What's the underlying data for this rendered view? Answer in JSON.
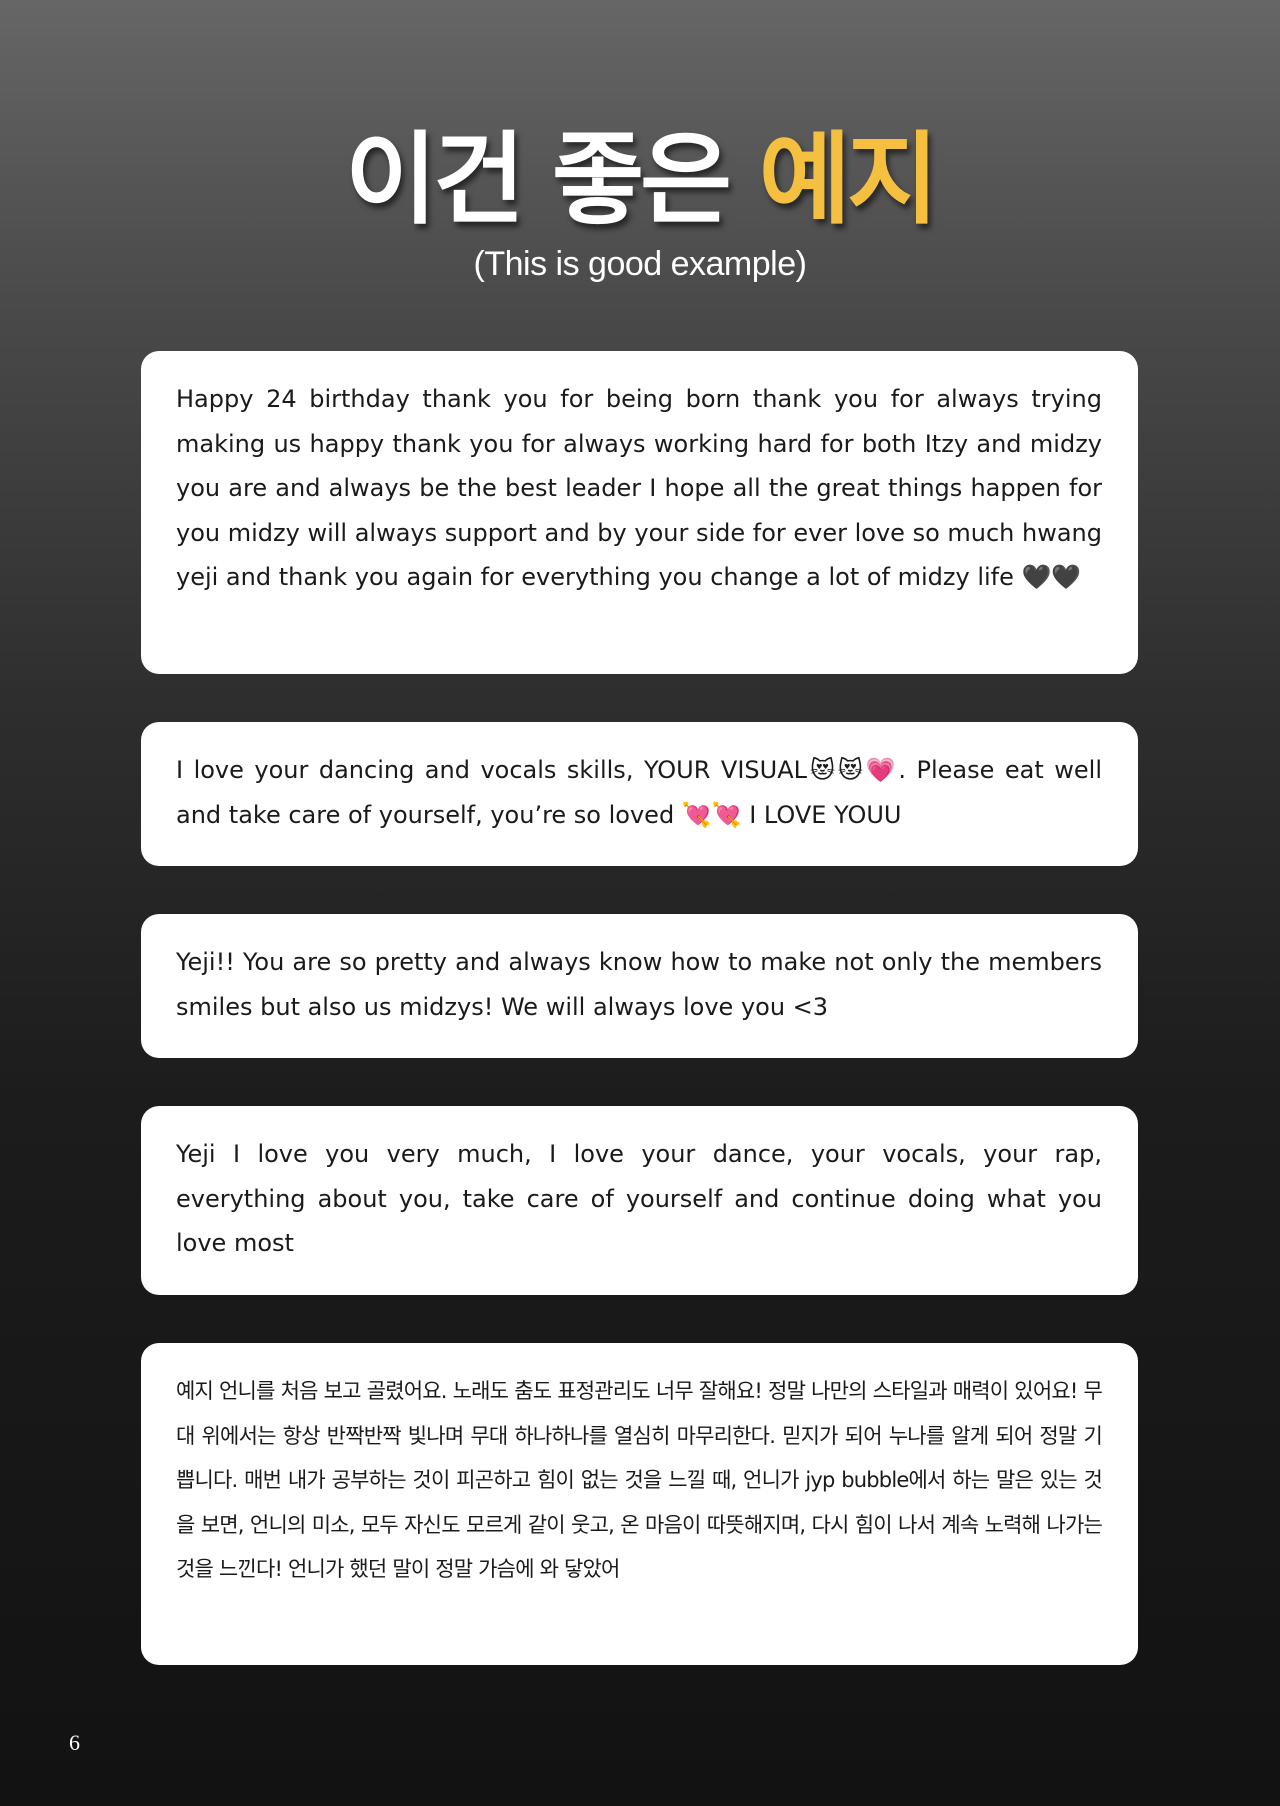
{
  "header": {
    "title_part1": "이건 좋은",
    "title_part2": "예지",
    "subtitle": "(This is good example)"
  },
  "messages": [
    {
      "text": "Happy 24 birthday thank you for being born thank you for always trying making us happy thank you for always working hard for both Itzy and midzy you are and always be the best leader I hope all the great things happen for you midzy will always support and by your side for ever love so much hwang yeji and thank you again for everything you change a lot of midzy life 🖤🖤"
    },
    {
      "text": "I love your dancing and vocals skills, YOUR VISUAL😻😻💗. Please eat well and take care of yourself, you’re so loved 💘💘 I LOVE YOUU"
    },
    {
      "text": "Yeji!! You are so pretty and always know how to make not only the members smiles but also us midzys! We will always love you <3"
    },
    {
      "text": "Yeji I love you very much, I love your dance, your vocals, your rap, everything about you, take care of yourself and continue doing what you love most"
    },
    {
      "text": "예지 언니를 처음 보고 골렸어요. 노래도 춤도 표정관리도 너무 잘해요! 정말 나만의 스타일과 매력이 있어요! 무대 위에서는 항상 반짝반짝 빛나며 무대 하나하나를 열심히 마무리한다. 믿지가 되어 누나를 알게 되어 정말 기쁩니다. 매번 내가 공부하는 것이 피곤하고 힘이 없는 것을 느낄 때, 언니가 jyp bubble에서 하는 말은 있는 것을 보면, 언니의 미소, 모두 자신도 모르게 같이 웃고, 온 마음이 따뜻해지며, 다시 힘이 나서 계속 노력해 나가는 것을 느낀다! 언니가 했던 말이 정말 가슴에 와 닿았어"
    }
  ],
  "footer": {
    "page_number": "6"
  },
  "colors": {
    "accent": "#f5c040",
    "card_background": "#ffffff",
    "page_text": "#ffffff"
  }
}
